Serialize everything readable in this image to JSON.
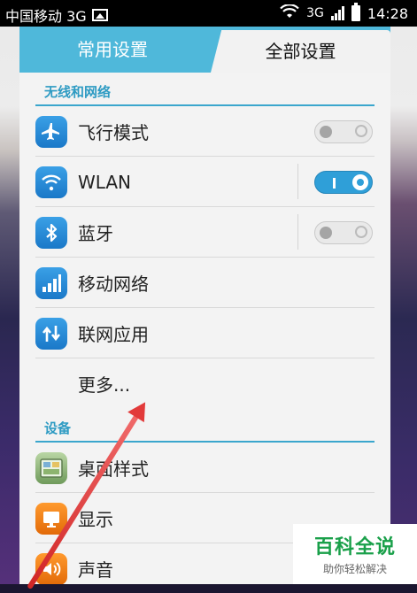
{
  "status_bar": {
    "carrier": "中国移动 3G",
    "network": "3G",
    "time": "14:28"
  },
  "tabs": {
    "common": "常用设置",
    "all": "全部设置"
  },
  "sections": {
    "wireless": "无线和网络",
    "device": "设备"
  },
  "rows": {
    "airplane": "飞行模式",
    "wlan": "WLAN",
    "bluetooth": "蓝牙",
    "mobile_network": "移动网络",
    "network_apps": "联网应用",
    "more": "更多...",
    "desktop_style": "桌面样式",
    "display": "显示",
    "sound": "声音"
  },
  "toggles": {
    "airplane": "off",
    "wlan": "on",
    "bluetooth": "off"
  },
  "watermark": {
    "title": "百科全说",
    "subtitle": "助你轻松解决"
  },
  "icons": {
    "airplane": "airplane-icon",
    "wlan": "wifi-icon",
    "bluetooth": "bluetooth-icon",
    "mobile_network": "signal-icon",
    "network_apps": "data-arrows-icon",
    "desktop_style": "desktop-style-icon",
    "display": "display-icon",
    "sound": "speaker-icon"
  },
  "colors": {
    "accent": "#4fb8da",
    "section_text": "#2e9bc3",
    "toggle_on": "#2f9fd8",
    "icon_blue": "#1a78c8",
    "icon_orange": "#e26a08",
    "arrow": "#d12525",
    "watermark_green": "#1aa04a"
  }
}
